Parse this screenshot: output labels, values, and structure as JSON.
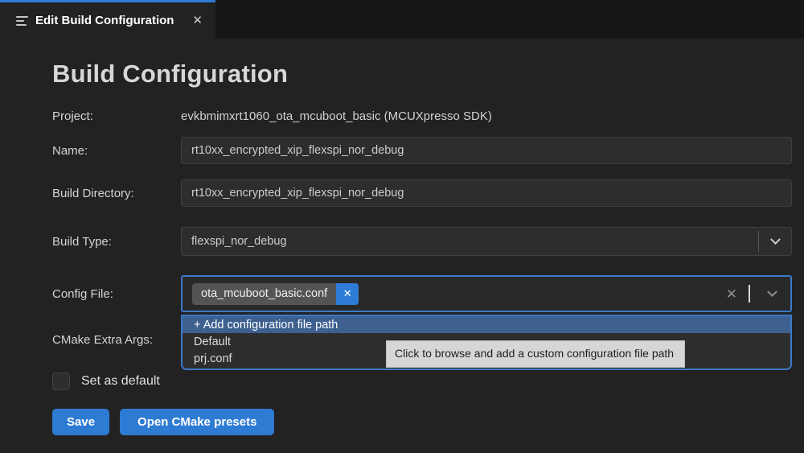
{
  "tab": {
    "title": "Edit Build Configuration"
  },
  "icons": {
    "tab_close": "✕",
    "chip_remove": "✕",
    "clear": "✕"
  },
  "page": {
    "heading": "Build Configuration"
  },
  "fields": {
    "project": {
      "label": "Project:",
      "value": "evkbmimxrt1060_ota_mcuboot_basic (MCUXpresso SDK)"
    },
    "name": {
      "label": "Name:",
      "value": "rt10xx_encrypted_xip_flexspi_nor_debug"
    },
    "build_directory": {
      "label": "Build Directory:",
      "value": "rt10xx_encrypted_xip_flexspi_nor_debug"
    },
    "build_type": {
      "label": "Build Type:",
      "value": "flexspi_nor_debug"
    },
    "config_file": {
      "label": "Config File:",
      "chip": "ota_mcuboot_basic.conf"
    },
    "cmake_extra_args": {
      "label": "CMake Extra Args:"
    }
  },
  "dropdown": {
    "items": [
      {
        "label": "+ Add configuration file path",
        "highlighted": true
      },
      {
        "label": "Default",
        "highlighted": false
      },
      {
        "label": "prj.conf",
        "highlighted": false
      }
    ]
  },
  "tooltip": {
    "text": "Click to browse and add a custom configuration file path"
  },
  "checkbox": {
    "label": "Set as default",
    "checked": false
  },
  "buttons": {
    "save": "Save",
    "open_presets": "Open CMake presets"
  },
  "colors": {
    "accent_blue": "#2f7bd6",
    "focus_border": "#3c79c9",
    "button_blue": "#2e7bd4",
    "dropdown_highlight": "#3d6090",
    "chip_gray": "#545454",
    "chip_close_blue": "#2e7cd6",
    "tooltip_bg": "#d6d6d6",
    "editor_bg": "#222222",
    "tabbar_bg": "#161616",
    "input_bg": "#2d2d2d"
  }
}
